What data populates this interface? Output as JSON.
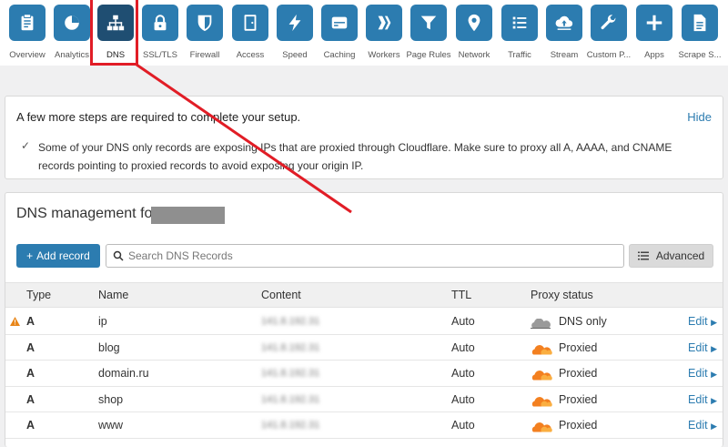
{
  "nav": {
    "items": [
      {
        "label": "Overview",
        "icon": "clipboard-icon"
      },
      {
        "label": "Analytics",
        "icon": "pie-chart-icon"
      },
      {
        "label": "DNS",
        "icon": "sitemap-icon",
        "active": true
      },
      {
        "label": "SSL/TLS",
        "icon": "lock-icon"
      },
      {
        "label": "Firewall",
        "icon": "shield-icon"
      },
      {
        "label": "Access",
        "icon": "door-icon"
      },
      {
        "label": "Speed",
        "icon": "lightning-icon"
      },
      {
        "label": "Caching",
        "icon": "drive-icon"
      },
      {
        "label": "Workers",
        "icon": "workers-icon"
      },
      {
        "label": "Page Rules",
        "icon": "filter-icon"
      },
      {
        "label": "Network",
        "icon": "location-pin-icon"
      },
      {
        "label": "Traffic",
        "icon": "list-icon"
      },
      {
        "label": "Stream",
        "icon": "cloud-upload-icon"
      },
      {
        "label": "Custom P...",
        "icon": "wrench-icon"
      },
      {
        "label": "Apps",
        "icon": "plus-icon"
      },
      {
        "label": "Scrape S...",
        "icon": "document-icon"
      }
    ]
  },
  "setup": {
    "title": "A few more steps are required to complete your setup.",
    "hide_label": "Hide",
    "message": "Some of your DNS only records are exposing IPs that are proxied through Cloudflare. Make sure to proxy all A, AAAA, and CNAME records pointing to proxied records to avoid exposing your origin IP."
  },
  "dns": {
    "title": "DNS management for",
    "add_label": "Add record",
    "search_placeholder": "Search DNS Records",
    "advanced_label": "Advanced",
    "columns": {
      "type": "Type",
      "name": "Name",
      "content": "Content",
      "ttl": "TTL",
      "proxy": "Proxy status"
    },
    "edit_label": "Edit",
    "rows": [
      {
        "type": "A",
        "name": "ip",
        "content": "141.8.192.31",
        "ttl": "Auto",
        "proxy": "DNS only",
        "warning": true
      },
      {
        "type": "A",
        "name": "blog",
        "content": "141.8.192.31",
        "ttl": "Auto",
        "proxy": "Proxied"
      },
      {
        "type": "A",
        "name": "domain.ru",
        "content": "141.8.192.31",
        "ttl": "Auto",
        "proxy": "Proxied"
      },
      {
        "type": "A",
        "name": "shop",
        "content": "141.8.192.31",
        "ttl": "Auto",
        "proxy": "Proxied"
      },
      {
        "type": "A",
        "name": "www",
        "content": "141.8.192.31",
        "ttl": "Auto",
        "proxy": "Proxied"
      }
    ]
  },
  "colors": {
    "accent": "#2c7cb0",
    "annotation": "#e11d26",
    "proxied": "#f38020",
    "dns_only": "#9a9a9a"
  }
}
